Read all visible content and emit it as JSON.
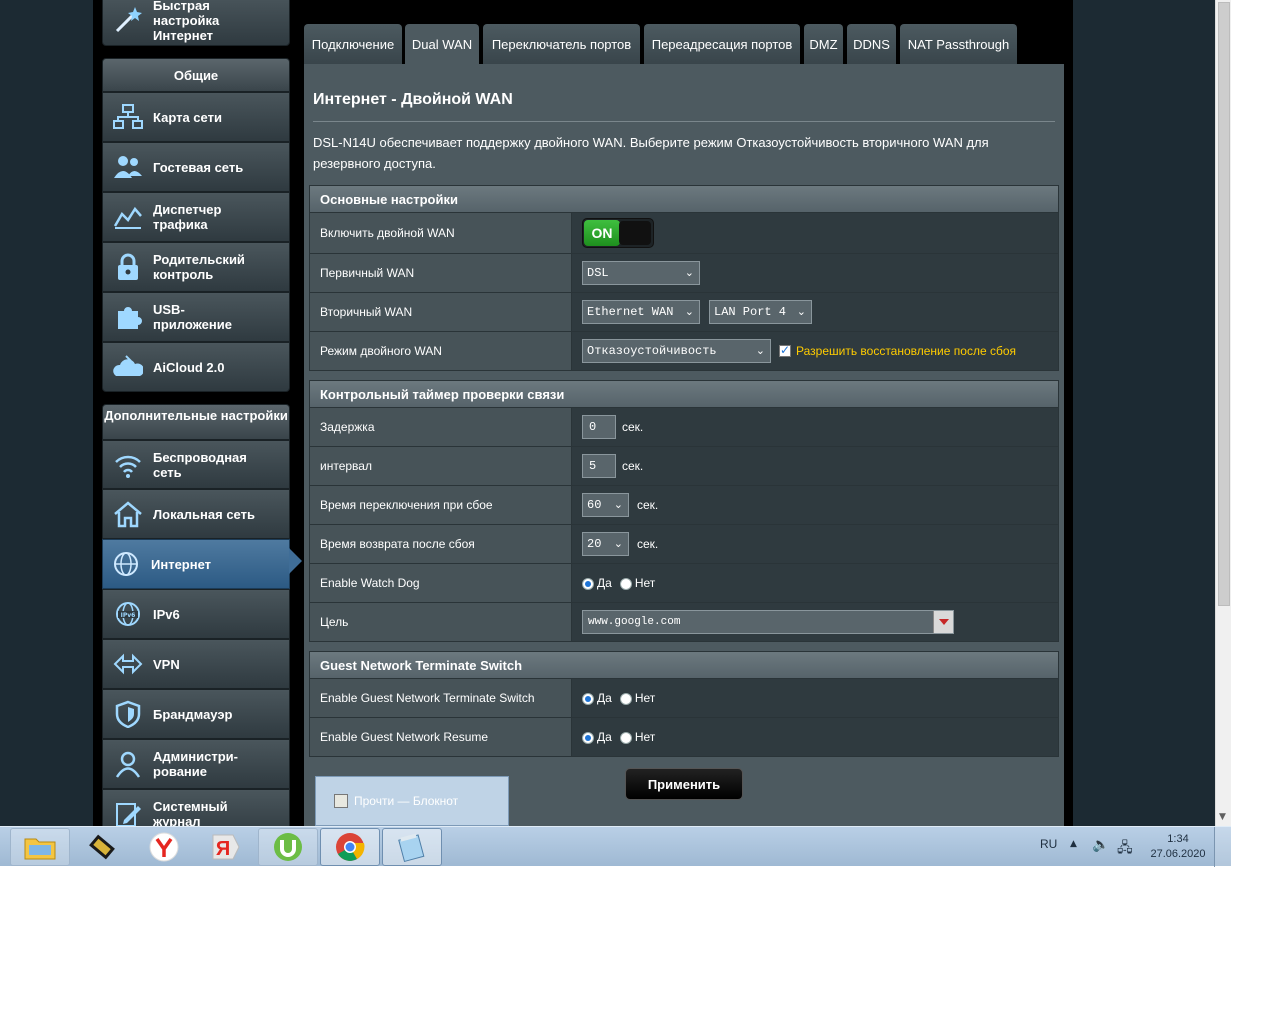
{
  "sidebar": {
    "quick_setup": "Быстрая настройка Интернет",
    "general_header": "Общие",
    "general_items": [
      {
        "label": "Карта сети",
        "icon": "network-map-icon"
      },
      {
        "label": "Гостевая сеть",
        "icon": "guest-network-icon"
      },
      {
        "label": "Диспетчер трафика",
        "icon": "traffic-manager-icon"
      },
      {
        "label": "Родительский контроль",
        "icon": "lock-icon"
      },
      {
        "label": "USB-приложение",
        "icon": "puzzle-icon"
      },
      {
        "label": "AiCloud 2.0",
        "icon": "cloud-icon"
      }
    ],
    "advanced_header": "Дополнительные настройки",
    "advanced_items": [
      {
        "label": "Беспроводная сеть",
        "icon": "wifi-icon"
      },
      {
        "label": "Локальная сеть",
        "icon": "home-icon"
      },
      {
        "label": "Интернет",
        "icon": "globe-icon"
      },
      {
        "label": "IPv6",
        "icon": "ipv6-globe-icon"
      },
      {
        "label": "VPN",
        "icon": "vpn-icon"
      },
      {
        "label": "Брандмауэр",
        "icon": "shield-icon"
      },
      {
        "label": "Администри-рование",
        "icon": "admin-icon"
      },
      {
        "label": "Системный журнал",
        "icon": "log-icon"
      }
    ]
  },
  "tabs": [
    "Подключение",
    "Dual WAN",
    "Переключатель портов",
    "Переадресация портов",
    "DMZ",
    "DDNS",
    "NAT Passthrough"
  ],
  "active_tab": "Dual WAN",
  "page": {
    "title": "Интернет - Двойной WAN",
    "description": "DSL-N14U обеспечивает поддержку двойного WAN. Выберите режим Отказоустойчивость вторичного WAN для резервного доступа."
  },
  "basic": {
    "header": "Основные настройки",
    "enable_label": "Включить двойной WAN",
    "enable_state": "ON",
    "primary_label": "Первичный WAN",
    "primary_value": "DSL",
    "secondary_label": "Вторичный WAN",
    "secondary_value": "Ethernet WAN",
    "secondary_port": "LAN Port 4",
    "mode_label": "Режим двойного WAN",
    "mode_value": "Отказоустойчивость",
    "allow_restore_label": "Разрешить восстановление после сбоя"
  },
  "watch": {
    "header": "Контрольный таймер проверки связи",
    "delay_label": "Задержка",
    "delay_value": "0",
    "interval_label": "интервал",
    "interval_value": "5",
    "failover_label": "Время переключения при сбое",
    "failover_value": "60",
    "failback_label": "Время возврата после сбоя",
    "failback_value": "20",
    "unit": "сек.",
    "watchdog_label": "Enable Watch Dog",
    "target_label": "Цель",
    "target_value": "www.google.com"
  },
  "guest": {
    "header": "Guest Network Terminate Switch",
    "terminate_label": "Enable Guest Network Terminate Switch",
    "resume_label": "Enable Guest Network Resume"
  },
  "yes": "Да",
  "no": "Нет",
  "apply": "Применить",
  "notepad_window": "Прочти — Блокнот",
  "taskbar": {
    "lang": "RU",
    "time": "1:34",
    "date": "27.06.2020"
  }
}
